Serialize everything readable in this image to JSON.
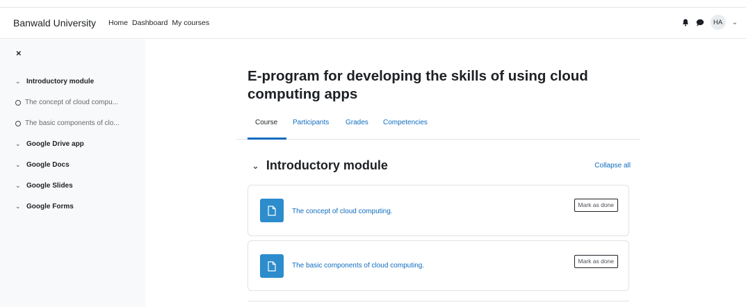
{
  "navbar": {
    "brand": "Banwald University",
    "links": [
      "Home",
      "Dashboard",
      "My courses"
    ],
    "user_initials": "HA"
  },
  "drawer": {
    "close": "×",
    "items": [
      {
        "type": "section",
        "label": "Introductory module"
      },
      {
        "type": "activity",
        "label": "The concept of cloud compu..."
      },
      {
        "type": "activity",
        "label": "The basic components of clo..."
      },
      {
        "type": "section",
        "label": "Google Drive app"
      },
      {
        "type": "section",
        "label": "Google Docs"
      },
      {
        "type": "section",
        "label": "Google Slides"
      },
      {
        "type": "section",
        "label": "Google Forms"
      }
    ]
  },
  "course": {
    "title": "E-program for developing the skills of using cloud computing apps",
    "tabs": [
      "Course",
      "Participants",
      "Grades",
      "Competencies"
    ],
    "active_tab": "Course"
  },
  "section": {
    "title": "Introductory module",
    "collapse_all": "Collapse all",
    "activities": [
      {
        "name": "The concept of cloud computing.",
        "button": "Mark as done"
      },
      {
        "name": "The basic components of cloud computing.",
        "button": "Mark as done"
      }
    ]
  },
  "colors": {
    "link": "#0f6cbf",
    "activity_icon": "#2d8ccc",
    "drawer_bg": "#f8f9fa"
  }
}
